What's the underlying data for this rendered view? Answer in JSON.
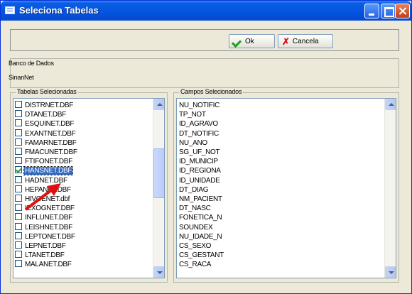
{
  "window": {
    "title": "Seleciona Tabelas"
  },
  "toolbar": {
    "ok_label": "Ok",
    "cancel_label": "Cancela"
  },
  "database": {
    "label": "Banco de Dados",
    "value": "SinanNet"
  },
  "tables": {
    "label": "Tabelas Selecionadas",
    "items": [
      {
        "name": "DISTRNET.DBF",
        "checked": false
      },
      {
        "name": "DTANET.DBF",
        "checked": false
      },
      {
        "name": "ESQUINET.DBF",
        "checked": false
      },
      {
        "name": "EXANTNET.DBF",
        "checked": false
      },
      {
        "name": "FAMARNET.DBF",
        "checked": false
      },
      {
        "name": "FMACUNET.DBF",
        "checked": false
      },
      {
        "name": "FTIFONET.DBF",
        "checked": false
      },
      {
        "name": "HANSNET.DBF",
        "checked": true,
        "selected": true
      },
      {
        "name": "HADNET.DBF",
        "checked": false
      },
      {
        "name": "HEPANET.DBF",
        "checked": false
      },
      {
        "name": "HIVGENET.dbf",
        "checked": false
      },
      {
        "name": "IEXOGNET.DBF",
        "checked": false
      },
      {
        "name": "INFLUNET.DBF",
        "checked": false
      },
      {
        "name": "LEISHNET.DBF",
        "checked": false
      },
      {
        "name": "LEPTONET.DBF",
        "checked": false
      },
      {
        "name": "LEPNET.DBF",
        "checked": false
      },
      {
        "name": "LTANET.DBF",
        "checked": false
      },
      {
        "name": "MALANET.DBF",
        "checked": false
      }
    ]
  },
  "fields": {
    "label": "Campos Selecionados",
    "items": [
      "NU_NOTIFIC",
      "TP_NOT",
      "ID_AGRAVO",
      "DT_NOTIFIC",
      "NU_ANO",
      "SG_UF_NOT",
      "ID_MUNICIP",
      "ID_REGIONA",
      "ID_UNIDADE",
      "DT_DIAG",
      "NM_PACIENT",
      "DT_NASC",
      "FONETICA_N",
      "SOUNDEX",
      "NU_IDADE_N",
      "CS_SEXO",
      "CS_GESTANT",
      "CS_RACA"
    ]
  }
}
